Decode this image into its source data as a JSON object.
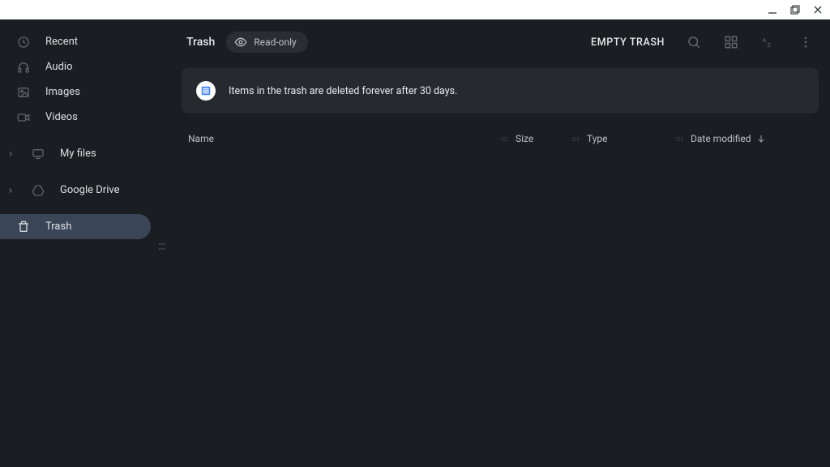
{
  "window": {
    "minimize": "–",
    "maximize": "❐",
    "close": "✕"
  },
  "sidebar": {
    "items": [
      {
        "id": "recent",
        "label": "Recent",
        "icon": "clock"
      },
      {
        "id": "audio",
        "label": "Audio",
        "icon": "headphones"
      },
      {
        "id": "images",
        "label": "Images",
        "icon": "image"
      },
      {
        "id": "videos",
        "label": "Videos",
        "icon": "video"
      }
    ],
    "groups": [
      {
        "id": "myfiles",
        "label": "My files",
        "icon": "monitor"
      },
      {
        "id": "gdrive",
        "label": "Google Drive",
        "icon": "drive"
      }
    ],
    "trash": {
      "label": "Trash",
      "icon": "trash"
    }
  },
  "header": {
    "title": "Trash",
    "readonly_label": "Read-only",
    "empty_trash_label": "EMPTY TRASH"
  },
  "banner": {
    "text": "Items in the trash are deleted forever after 30 days."
  },
  "columns": {
    "name": "Name",
    "size": "Size",
    "type": "Type",
    "date": "Date modified"
  },
  "sort": {
    "column": "date",
    "direction": "desc"
  }
}
